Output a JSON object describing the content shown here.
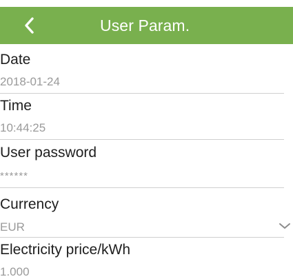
{
  "header": {
    "title": "User Param.",
    "back_icon": "chevron-left-icon",
    "color": "#79b04e"
  },
  "fields": [
    {
      "label": "Date",
      "value": "2018-01-24"
    },
    {
      "label": "Time",
      "value": "10:44:25"
    },
    {
      "label": "User password",
      "value": "******"
    },
    {
      "label": "Currency",
      "value": "EUR",
      "dropdown_icon": "chevron-down-icon"
    },
    {
      "label": "Electricity price/kWh",
      "value": "1.000"
    }
  ]
}
